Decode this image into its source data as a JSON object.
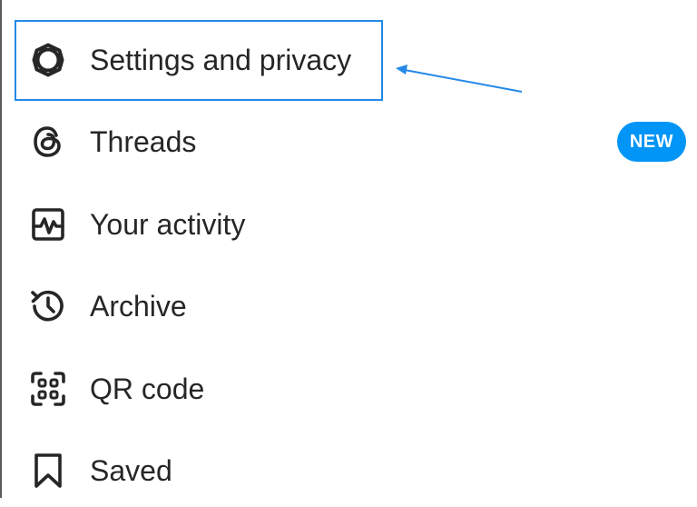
{
  "menu": {
    "items": [
      {
        "label": "Settings and privacy",
        "icon": "gear-icon"
      },
      {
        "label": "Threads",
        "icon": "threads-icon",
        "badge": "NEW"
      },
      {
        "label": "Your activity",
        "icon": "activity-icon"
      },
      {
        "label": "Archive",
        "icon": "archive-icon"
      },
      {
        "label": "QR code",
        "icon": "qr-code-icon"
      },
      {
        "label": "Saved",
        "icon": "bookmark-icon"
      }
    ]
  },
  "colors": {
    "annotation": "#2489e8",
    "badge": "#0095f6",
    "text": "#262626"
  }
}
